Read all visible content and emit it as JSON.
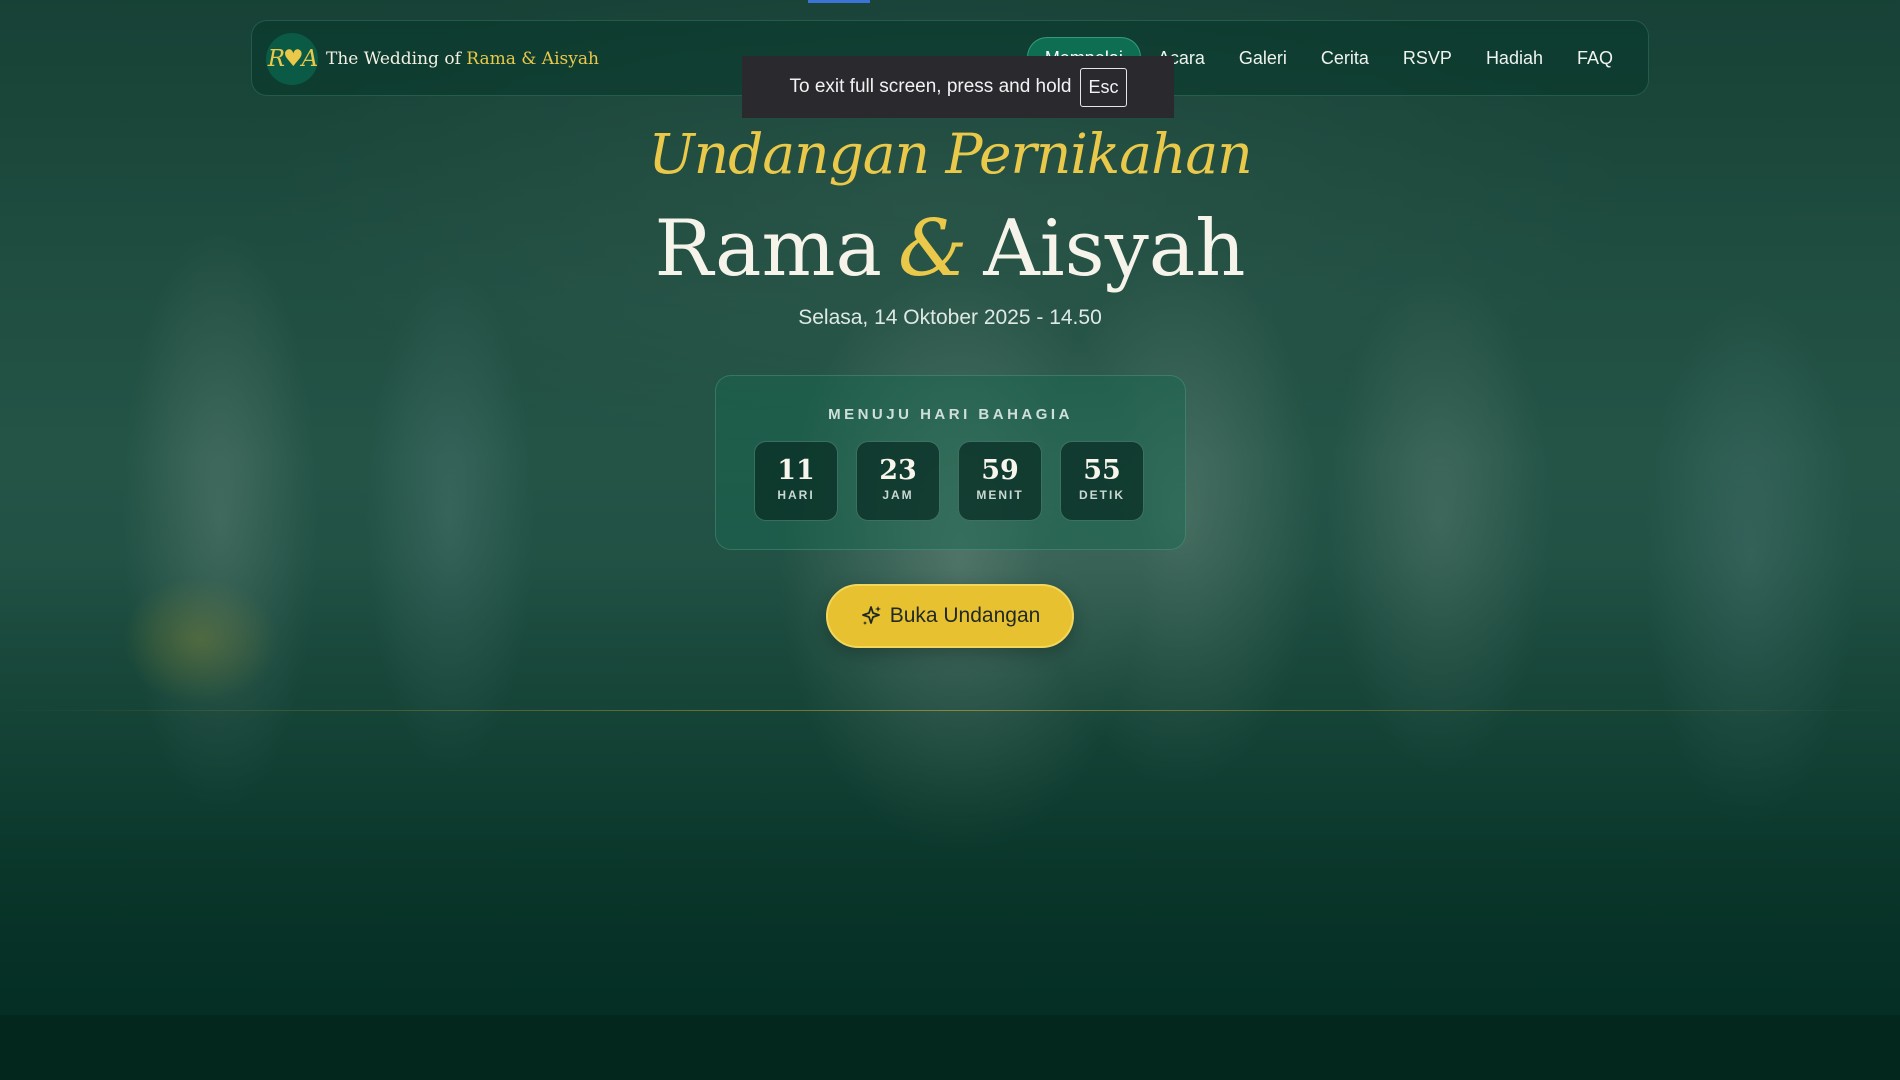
{
  "brand": {
    "monogram": "R♥A",
    "prefix": "The Wedding of",
    "couple": "Rama & Aisyah"
  },
  "nav": {
    "items": [
      {
        "label": "Mempelai",
        "active": true
      },
      {
        "label": "Acara"
      },
      {
        "label": "Galeri"
      },
      {
        "label": "Cerita"
      },
      {
        "label": "RSVP"
      },
      {
        "label": "Hadiah"
      },
      {
        "label": "FAQ"
      }
    ]
  },
  "fullscreen_toast": {
    "text": "To exit full screen, press and hold",
    "key": "Esc"
  },
  "hero": {
    "subtitle": "Undangan Pernikahan",
    "groom": "Rama",
    "ampersand": "&",
    "bride": "Aisyah",
    "date": "Selasa, 14 Oktober 2025 - 14.50"
  },
  "countdown": {
    "title": "MENUJU HARI BAHAGIA",
    "units": [
      {
        "value": "11",
        "label": "HARI"
      },
      {
        "value": "23",
        "label": "JAM"
      },
      {
        "value": "59",
        "label": "MENIT"
      },
      {
        "value": "55",
        "label": "DETIK"
      }
    ]
  },
  "cta": {
    "label": "Buka Undangan",
    "icon": "sparkles-icon"
  },
  "colors": {
    "primary_green": "#0e6e52",
    "gold": "#e9c84a",
    "cta_yellow": "#e8c130",
    "background": "#04281f"
  }
}
